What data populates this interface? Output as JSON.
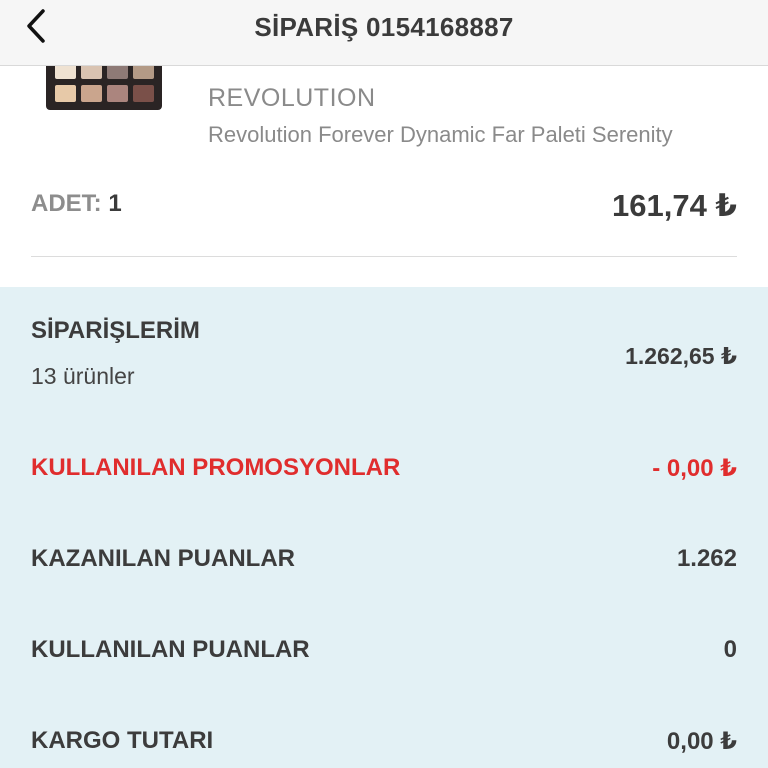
{
  "header": {
    "title": "SİPARİŞ 0154168887",
    "back_icon": "chevron-left-icon"
  },
  "product": {
    "brand": "REVOLUTION",
    "name": "Revolution Forever Dynamic Far Paleti Serenity",
    "qty_label": "ADET:",
    "qty_value": "1",
    "price": "161,74 ₺",
    "palette_colors": [
      "#efe2d2",
      "#d9c3b1",
      "#8e7a76",
      "#b39a86",
      "#e7c9a8",
      "#caa58d",
      "#ab857e",
      "#7a5049"
    ]
  },
  "summary": {
    "orders_label": "SİPARİŞLERİM",
    "orders_count": "13 ürünler",
    "orders_total": "1.262,65 ₺",
    "promo_label": "KULLANILAN PROMOSYONLAR",
    "promo_value": "- 0,00 ₺",
    "earned_points_label": "KAZANILAN PUANLAR",
    "earned_points_value": "1.262",
    "used_points_label": "KULLANILAN PUANLAR",
    "used_points_value": "0",
    "shipping_label": "KARGO TUTARI",
    "shipping_value": "0,00 ₺"
  },
  "colors": {
    "summary_bg": "#e3f1f5",
    "promo_red": "#e02d2d",
    "text_dark": "#3c3c3c",
    "text_gray": "#8a8a8a"
  }
}
